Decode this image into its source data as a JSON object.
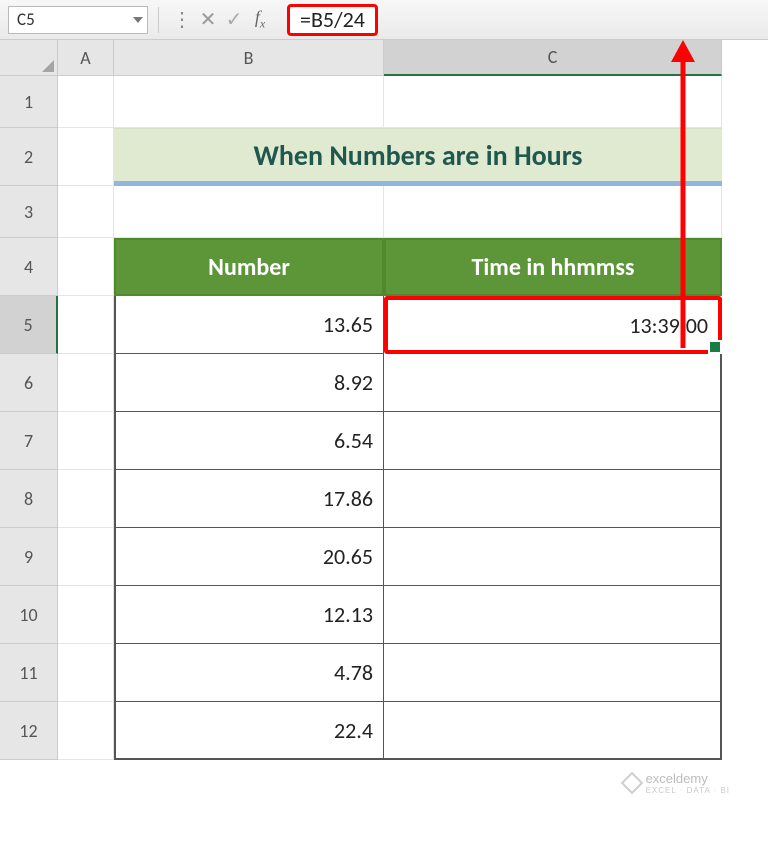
{
  "name_box": "C5",
  "formula": "=B5/24",
  "col_headers": [
    "A",
    "B",
    "C"
  ],
  "row_headers": [
    "1",
    "2",
    "3",
    "4",
    "5",
    "6",
    "7",
    "8",
    "9",
    "10",
    "11",
    "12"
  ],
  "title": "When Numbers are in Hours",
  "table_headers": {
    "b": "Number",
    "c": "Time in hhmmss"
  },
  "rows": [
    {
      "b": "13.65",
      "c": "13:39:00"
    },
    {
      "b": "8.92",
      "c": ""
    },
    {
      "b": "6.54",
      "c": ""
    },
    {
      "b": "17.86",
      "c": ""
    },
    {
      "b": "20.65",
      "c": ""
    },
    {
      "b": "12.13",
      "c": ""
    },
    {
      "b": "4.78",
      "c": ""
    },
    {
      "b": "22.4",
      "c": ""
    }
  ],
  "active": {
    "row": 5,
    "col": "C"
  },
  "watermark": {
    "brand": "exceldemy",
    "tag": "EXCEL · DATA · BI"
  }
}
